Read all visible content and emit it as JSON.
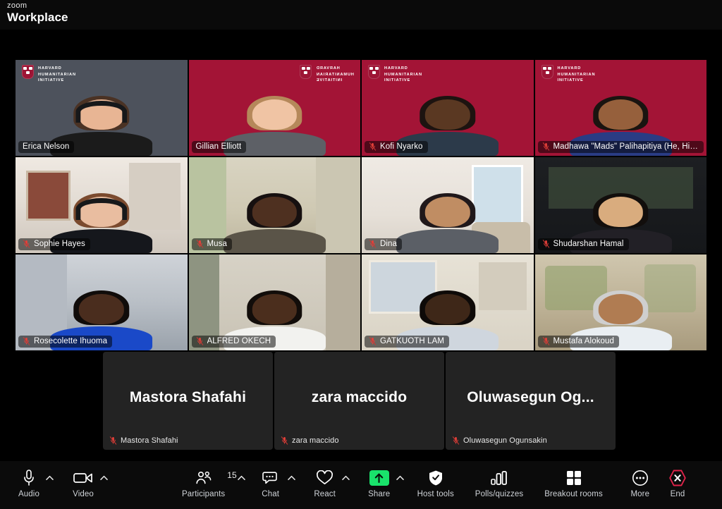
{
  "app": {
    "brand_line1": "zoom",
    "brand_line2": "Workplace"
  },
  "colors": {
    "harvard_crimson": "#a31436",
    "active_speaker_green": "#19e36b",
    "share_green": "#19e36b",
    "end_red": "#e0234a",
    "mute_red": "#e8403a",
    "toolbar_bg": "#0b0b0b",
    "tile_placeholder_bg": "#232323"
  },
  "gallery": {
    "tiles": [
      {
        "name": "Erica Nelson",
        "muted": false,
        "speaking": true,
        "bg": "hhi-dark",
        "logo": "normal",
        "logo_side": "left",
        "skin": "#e8b594",
        "hair": "#4a3224",
        "shirt": "#1b1b1b",
        "headset": true
      },
      {
        "name": "Gillian Elliott",
        "muted": false,
        "speaking": false,
        "bg": "hhi",
        "logo": "mirrored",
        "logo_side": "right",
        "skin": "#f0c4a4",
        "hair": "#b5885a",
        "shirt": "#5d6066",
        "headset": false
      },
      {
        "name": "Kofi Nyarko",
        "muted": true,
        "speaking": false,
        "bg": "hhi",
        "logo": "normal",
        "logo_side": "left",
        "skin": "#5a3822",
        "hair": "#1d1310",
        "shirt": "#2c3a4a",
        "headset": false
      },
      {
        "name": "Madhawa  \"Mads\" Palihapitiya (He, Him)",
        "muted": true,
        "speaking": false,
        "bg": "hhi",
        "logo": "normal",
        "logo_side": "left",
        "skin": "#96603c",
        "hair": "#1a1410",
        "shirt": "#2a3c84",
        "headset": false
      },
      {
        "name": "Sophie Hayes",
        "muted": true,
        "speaking": false,
        "bg": "room-a",
        "logo": "none",
        "logo_side": "left",
        "skin": "#e9bda0",
        "hair": "#7b4a2e",
        "shirt": "#15171c",
        "headset": true
      },
      {
        "name": "Musa",
        "muted": true,
        "speaking": false,
        "bg": "room-b",
        "logo": "none",
        "logo_side": "left",
        "skin": "#4e3020",
        "hair": "#161010",
        "shirt": "#5a5448",
        "headset": false
      },
      {
        "name": "Dina",
        "muted": true,
        "speaking": false,
        "bg": "room-c",
        "logo": "none",
        "logo_side": "left",
        "skin": "#c08d63",
        "hair": "#20181a",
        "shirt": "#5b5f66",
        "headset": false
      },
      {
        "name": "Shudarshan Hamal",
        "muted": true,
        "speaking": false,
        "bg": "room-d",
        "logo": "none",
        "logo_side": "left",
        "skin": "#d9ac7e",
        "hair": "#120e0c",
        "shirt": "#222026",
        "headset": false
      },
      {
        "name": "Rosecolette Ihuoma",
        "muted": true,
        "speaking": false,
        "bg": "room-e",
        "logo": "none",
        "logo_side": "left",
        "skin": "#4a2d1e",
        "hair": "#100c0a",
        "shirt": "#1a49c8",
        "headset": false
      },
      {
        "name": "ALFRED OKECH",
        "muted": true,
        "speaking": false,
        "bg": "room-f",
        "logo": "none",
        "logo_side": "left",
        "skin": "#4b2e1d",
        "hair": "#120d0a",
        "shirt": "#f2f2ef",
        "headset": false
      },
      {
        "name": "GATKUOTH LAM",
        "muted": true,
        "speaking": false,
        "bg": "room-g",
        "logo": "none",
        "logo_side": "left",
        "skin": "#3e2718",
        "hair": "#0e0a08",
        "shirt": "#cfd6de",
        "headset": false
      },
      {
        "name": "Mustafa Alokoud",
        "muted": true,
        "speaking": false,
        "bg": "room-h",
        "logo": "none",
        "logo_side": "left",
        "skin": "#b07c52",
        "hair": "#cfcfcf",
        "shirt": "#e9eef2",
        "headset": false
      }
    ],
    "placeholder_tiles": [
      {
        "display_name": "Mastora Shafahi",
        "label": "Mastora Shafahi",
        "muted": true
      },
      {
        "display_name": "zara maccido",
        "label": "zara maccido",
        "muted": true
      },
      {
        "display_name": "Oluwasegun  Og...",
        "label": "Oluwasegun Ogunsakin",
        "muted": true
      }
    ]
  },
  "toolbar": {
    "left": [
      {
        "id": "audio",
        "label": "Audio",
        "icon": "microphone-icon",
        "has_chevron": true,
        "count": null
      },
      {
        "id": "video",
        "label": "Video",
        "icon": "camera-icon",
        "has_chevron": true,
        "count": null
      }
    ],
    "center": [
      {
        "id": "participants",
        "label": "Participants",
        "icon": "people-icon",
        "has_chevron": true,
        "count": "15"
      },
      {
        "id": "chat",
        "label": "Chat",
        "icon": "chat-bubble-icon",
        "has_chevron": true,
        "count": null
      },
      {
        "id": "react",
        "label": "React",
        "icon": "heart-icon",
        "has_chevron": true,
        "count": null
      },
      {
        "id": "share",
        "label": "Share",
        "icon": "share-arrow-icon",
        "has_chevron": true,
        "count": null
      },
      {
        "id": "host-tools",
        "label": "Host tools",
        "icon": "shield-icon",
        "has_chevron": false,
        "count": null
      },
      {
        "id": "polls",
        "label": "Polls/quizzes",
        "icon": "bar-chart-icon",
        "has_chevron": false,
        "count": null
      },
      {
        "id": "breakout",
        "label": "Breakout rooms",
        "icon": "grid-squares-icon",
        "has_chevron": false,
        "count": null
      },
      {
        "id": "more",
        "label": "More",
        "icon": "ellipsis-icon",
        "has_chevron": false,
        "count": null
      }
    ],
    "right": [
      {
        "id": "end",
        "label": "End",
        "icon": "end-call-icon",
        "has_chevron": false,
        "count": null
      }
    ]
  },
  "hhi_logo_text": "HARVARD\nHUMANITARIAN\nINITIATIVE"
}
